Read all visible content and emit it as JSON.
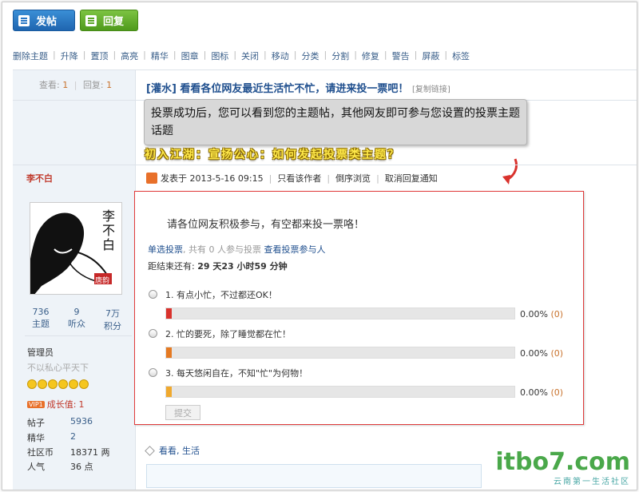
{
  "toolbar": {
    "post_label": "发帖",
    "reply_label": "回复"
  },
  "mod_actions": [
    "删除主题",
    "升降",
    "置顶",
    "高亮",
    "精华",
    "图章",
    "图标",
    "关闭",
    "移动",
    "分类",
    "分割",
    "修复",
    "警告",
    "屏蔽",
    "标签"
  ],
  "thread": {
    "view_label": "查看:",
    "view_count": "1",
    "reply_label": "回复:",
    "reply_count": "1",
    "title": "[灌水] 看看各位网友最近生活忙不忙，请进来投一票吧！",
    "copy_link": "[复制链接]"
  },
  "callout": {
    "text": "投票成功后，您可以看到您的主题帖，其他网友即可参与您设置的投票主题话题",
    "headline": "初入江湖：宣扬公心：如何发起投票类主题？"
  },
  "author": {
    "name": "李不白",
    "avatar_text": "李不白",
    "avatar_seal": "唐韵",
    "stats": [
      {
        "value": "736",
        "label": "主题"
      },
      {
        "value": "9",
        "label": "听众"
      },
      {
        "value": "7万",
        "label": "积分"
      }
    ],
    "group": "管理员",
    "motto": "不以私心平天下",
    "growth_badge": "VIP1",
    "growth_label": "成长值:",
    "growth_value": "1",
    "fields": [
      {
        "k": "帖子",
        "v": "5936"
      },
      {
        "k": "精华",
        "v": "2"
      },
      {
        "k": "社区币",
        "v": "18371 两"
      },
      {
        "k": "人气",
        "v": "36 点"
      }
    ]
  },
  "post": {
    "posted_at": "发表于 2013-5-16 09:15",
    "links": [
      "只看该作者",
      "倒序浏览",
      "取消回复通知"
    ]
  },
  "poll": {
    "intro": "请各位网友积极参与，有空都来投一票咯！",
    "type_label": "单选投票",
    "participants": ", 共有 0 人参与投票",
    "view_voters": "查看投票参与人",
    "remaining_label": "距结束还有:",
    "remaining": "29 天23 小时59 分钟",
    "options": [
      {
        "label": "1.  有点小忙，不过都还OK！",
        "percent": "0.00%",
        "count": "(0)",
        "color": "#d9322d",
        "fraction": 0
      },
      {
        "label": "2.  忙的要死，除了睡觉都在忙！",
        "percent": "0.00%",
        "count": "(0)",
        "color": "#e57a22",
        "fraction": 0
      },
      {
        "label": "3.  每天悠闲自在，不知\"忙\"为何物！",
        "percent": "0.00%",
        "count": "(0)",
        "color": "#f0a92e",
        "fraction": 0
      }
    ],
    "submit_label": "提交"
  },
  "tags": "看看, 生活",
  "watermark": {
    "main": "itbo7.com",
    "sub": "云南第一生活社区"
  }
}
